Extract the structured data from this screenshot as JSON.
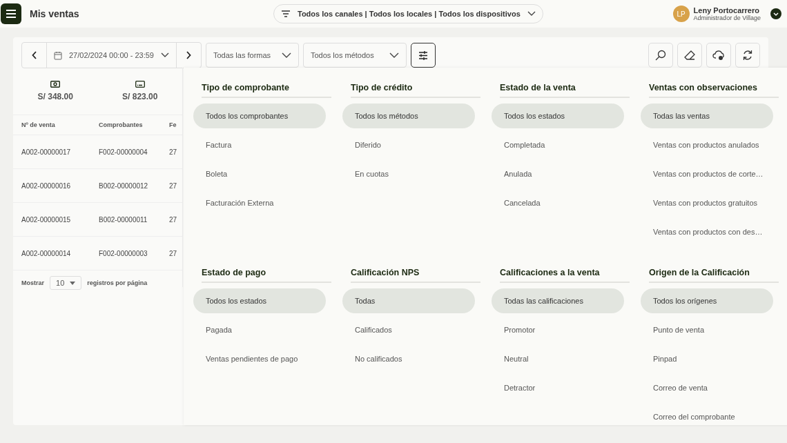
{
  "header": {
    "title": "Mis ventas",
    "scope": "Todos los canales | Todos los locales | Todos los dispositivos",
    "user": {
      "initials": "LP",
      "name": "Leny Portocarrero",
      "role": "Administrador de Village"
    }
  },
  "toolbar": {
    "date_range": "27/02/2024 00:00 - 23:59",
    "forms_select": "Todas las formas",
    "methods_select": "Todos los métodos",
    "filters_open": true
  },
  "summary": [
    {
      "kind": "cash",
      "amount": "S/ 348.00"
    },
    {
      "kind": "card",
      "amount": "S/ 823.00"
    }
  ],
  "table": {
    "columns": [
      "Nº de venta",
      "Comprobantes",
      "Fe"
    ],
    "rows": [
      [
        "A002-00000017",
        "F002-00000004",
        "27"
      ],
      [
        "A002-00000016",
        "B002-00000012",
        "27"
      ],
      [
        "A002-00000015",
        "B002-00000011",
        "27"
      ],
      [
        "A002-00000014",
        "F002-00000003",
        "27"
      ]
    ],
    "page_size_label": "Mostrar",
    "page_size": "10",
    "page_size_suffix": "registros por página"
  },
  "filters": [
    {
      "title": "Tipo de comprobante",
      "options": [
        {
          "label": "Todos los comprobantes",
          "selected": true
        },
        {
          "label": "Factura",
          "selected": false
        },
        {
          "label": "Boleta",
          "selected": false
        },
        {
          "label": "Facturación Externa",
          "selected": false
        }
      ]
    },
    {
      "title": "Tipo de crédito",
      "options": [
        {
          "label": "Todos los métodos",
          "selected": true
        },
        {
          "label": "Diferido",
          "selected": false
        },
        {
          "label": "En cuotas",
          "selected": false
        }
      ]
    },
    {
      "title": "Estado de la venta",
      "options": [
        {
          "label": "Todos los estados",
          "selected": true
        },
        {
          "label": "Completada",
          "selected": false
        },
        {
          "label": "Anulada",
          "selected": false
        },
        {
          "label": "Cancelada",
          "selected": false
        }
      ]
    },
    {
      "title": "Ventas con observaciones",
      "options": [
        {
          "label": "Todas las ventas",
          "selected": true
        },
        {
          "label": "Ventas con productos anulados",
          "selected": false
        },
        {
          "label": "Ventas con productos de corte…",
          "selected": false
        },
        {
          "label": "Ventas con productos gratuitos",
          "selected": false
        },
        {
          "label": "Ventas con productos con des…",
          "selected": false
        }
      ]
    },
    {
      "title": "Estado de pago",
      "options": [
        {
          "label": "Todos los estados",
          "selected": true
        },
        {
          "label": "Pagada",
          "selected": false
        },
        {
          "label": "Ventas pendientes de pago",
          "selected": false
        }
      ]
    },
    {
      "title": "Calificación NPS",
      "options": [
        {
          "label": "Todas",
          "selected": true
        },
        {
          "label": "Calificados",
          "selected": false
        },
        {
          "label": "No calificados",
          "selected": false
        }
      ]
    },
    {
      "title": "Calificaciones a la venta",
      "options": [
        {
          "label": "Todas las calificaciones",
          "selected": true
        },
        {
          "label": "Promotor",
          "selected": false
        },
        {
          "label": "Neutral",
          "selected": false
        },
        {
          "label": "Detractor",
          "selected": false
        }
      ]
    },
    {
      "title": "Origen de la Calificación",
      "options": [
        {
          "label": "Todos los orígenes",
          "selected": true
        },
        {
          "label": "Punto de venta",
          "selected": false
        },
        {
          "label": "Pinpad",
          "selected": false
        },
        {
          "label": "Correo de venta",
          "selected": false
        },
        {
          "label": "Correo del comprobante",
          "selected": false
        }
      ]
    }
  ]
}
